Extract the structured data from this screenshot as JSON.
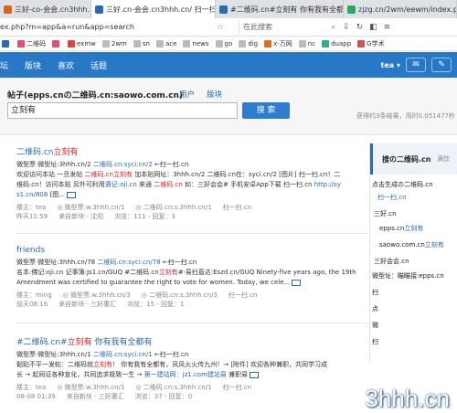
{
  "browser": {
    "tabs": [
      {
        "label": "三好-co-会会.cn3hhh...",
        "active": false,
        "color": "#e0621f"
      },
      {
        "label": "三好.cn-会会.cn3hhh.cn/ 扫一扫.cn",
        "active": true,
        "color": "#2a69b4"
      },
      {
        "label": "#二维码.cn#立刻有 你有我有全都有",
        "active": false,
        "color": "#2a69b4"
      },
      {
        "label": "zjzg.cn/2wm/eewm/index.php/...",
        "active": false,
        "color": "#2aa860"
      }
    ],
    "url": "ex.php?m=app&a=run&app=search",
    "search_placeholder": "在此搜索",
    "bookmarks": [
      {
        "label": "",
        "color": "#2a69b4"
      },
      {
        "label": "二维码",
        "color": "#e05070"
      },
      {
        "label": "",
        "color": "#e05070"
      },
      {
        "label": "exmw",
        "color": "#d44"
      },
      {
        "label": "2wm",
        "color": "#888"
      },
      {
        "label": "sn",
        "color": "#888"
      },
      {
        "label": "ace",
        "color": "#888"
      },
      {
        "label": "news",
        "color": "#888"
      },
      {
        "label": "go",
        "color": "#888"
      },
      {
        "label": "dig",
        "color": "#888"
      },
      {
        "label": "x-万网",
        "color": "#e07020"
      },
      {
        "label": "nc",
        "color": "#888"
      },
      {
        "label": "duapp",
        "color": "#3a8"
      },
      {
        "label": "G学术",
        "color": "#c55"
      }
    ]
  },
  "nav": {
    "items": [
      "坛",
      "版块",
      "喜欢",
      "话题"
    ],
    "user": "tea"
  },
  "search": {
    "title": "帖子(epps.cnの二维码.cn:saowo.com.cn)",
    "link_user": "用户",
    "link_board": "版块",
    "query": "立刻有",
    "button": "搜 索",
    "stat": "获得约3条结果，用时0.051477秒"
  },
  "results": [
    {
      "title_pre": "二维码.cn",
      "title_hl": "立刻有",
      "title_post": "",
      "body_l1_pre": "微型票·微型址:3hhh.cn/2 ",
      "body_l1_link": "二维码.cn:syci.cn/2",
      "body_l1_post": " ←扫一扫.cn",
      "body_l2_pre": "欢迎访问本站 一旦发帖 ",
      "body_l2_hl": "二维码.cn立刻有",
      "body_l2_post": " 加本贴网址：3hhh.cn/2 二维码.cn在：syci.cn/2 [图片] 扫一扫.cn！二",
      "body_l3_pre": "维码.cn！访问本贴 另外可利用",
      "body_l3_link": "遇记:oji.cn",
      "body_l3_mid": " 来通 ",
      "body_l3_hl": "二维码.cn",
      "body_l3_post": " 如：三好会会# 手机安卓App下载 扫一扫.cn ",
      "body_l3_link2": "http://sy",
      "body_l4_link": "s1.cn/808",
      "body_l4_post": " [图...",
      "meta_l1": [
        "楼主：tea",
        "◎ 微型票:w.3hhh.cn/1",
        "◎ 二维码.cn:s.3hhh.cn/1",
        "扫一扫.cn"
      ],
      "meta_l2": [
        "昨天11:59",
        "来自新块 - 沈阳",
        "浏览：111 - 回复：3"
      ]
    },
    {
      "title_pre": "friends",
      "title_hl": "",
      "title_post": "",
      "body_l1_pre": "微型票·微型址:3hhh.cn/78 ",
      "body_l1_link": "二维码.cn:syci.cn/78",
      "body_l1_post": " ←扫一扫.cn",
      "body_l2_pre": "名本:佛记:oji.cn 记事簿:Js1.cn/GUQ #二维码.cn",
      "body_l2_hl": "立刻有",
      "body_l2_post": "#·易扫直达:Eszd.cn/GUQ Ninety-five years ago, the 19th",
      "body_l3_pre": "Amendment was certified to guarantee the right to vote for women. Today, we cele...",
      "meta_l1": [
        "楼主：ming",
        "◎ 微型票:w.3hhh.cn/3",
        "◎ 二维码.cn:s.3hhh.cn/3",
        "扫一扫.cn"
      ],
      "meta_l2": [
        "前天08:16",
        "来自新块 - 三好惠汇",
        "浏览：15 - 回复：1"
      ]
    },
    {
      "title_pre": "#二维码.cn#",
      "title_hl": "立刻有",
      "title_post": " 你有我有全都有",
      "body_l1_pre": "微型票·微型址:3hhh.cn/1 ",
      "body_l1_link": "二维码.cn:syci.cn/1",
      "body_l1_post": " ←扫一扫.cn",
      "body_l2_pre": "黏贴不平一发帖：二维码就",
      "body_l2_hl": "立刻有",
      "body_l2_post": "！ 你有我有全都有，风风火火传九州！→ [附件] 欢迎各种兼职，共同学习成",
      "body_l3_pre": "长 → 起同证各种宣化，共同追求极致一生 → ",
      "body_l3_link": "第一建站网：jz1.com建站易",
      "body_l3_post": " 兼职易",
      "meta_l1": [
        "楼主：tea",
        "◎ 微型票:w.3hhh.cn/1",
        "◎ 二维码.cn:s.3hhh.cn/1",
        "扫一扫.cn"
      ],
      "meta_l2": [
        "08-08 01:39",
        "来自新块 - 三好惠汇",
        "浏览：37 - 回复：0"
      ]
    }
  ],
  "right_panel": {
    "title": "搜の二维码.cn",
    "title_suffix": "满饮",
    "items": [
      {
        "pre": "点击生成の二维码.cn",
        "link": ""
      },
      {
        "pre": "",
        "link": "扫一扫.cn"
      },
      {
        "pre": "三好.cn",
        "link": ""
      },
      {
        "pre": "epps.cn",
        "link": "立刻有"
      },
      {
        "pre": "saowo.com.cn",
        "link": "立刻有"
      },
      {
        "pre": "三好会会.cn",
        "link": ""
      },
      {
        "pre": "微型址：瞄瞄接:epps.cn",
        "link": ""
      },
      {
        "pre": "扫",
        "link": ""
      },
      {
        "pre": "点",
        "link": ""
      },
      {
        "pre": "微",
        "link": ""
      },
      {
        "pre": "扫",
        "link": ""
      }
    ]
  },
  "watermark": "3hhh.cn",
  "colors": {
    "nav_bg": "#2878c8",
    "link": "#2a69b4",
    "highlight": "#d22",
    "button": "#2e7cd0"
  }
}
